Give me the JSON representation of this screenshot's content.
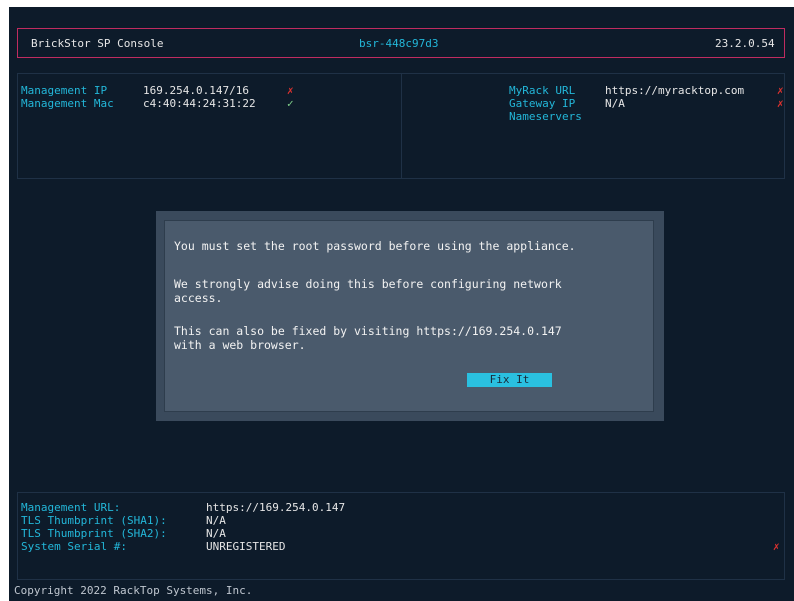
{
  "header": {
    "title": "BrickStor SP Console",
    "hostname": "bsr-448c97d3",
    "version": "23.2.0.54"
  },
  "network_left": {
    "mgmt_ip_label": "Management IP",
    "mgmt_ip_value": "169.254.0.147/16",
    "mgmt_ip_status": "✗",
    "mgmt_mac_label": "Management Mac",
    "mgmt_mac_value": "c4:40:44:24:31:22",
    "mgmt_mac_status": "✓"
  },
  "network_right": {
    "myrack_label": "MyRack URL",
    "myrack_value": "https://myracktop.com",
    "myrack_status": "✗",
    "gateway_label": "Gateway IP",
    "gateway_value": "N/A",
    "gateway_status": "✗",
    "nameservers_label": "Nameservers"
  },
  "dialog": {
    "line1": "You must set the root password before using the appliance.",
    "line2a": "We strongly advise doing this before configuring network",
    "line2b": "access.",
    "line3a": "This can also be fixed by visiting https://169.254.0.147",
    "line3b": "with a web browser.",
    "button_label": "Fix It"
  },
  "footer_info": {
    "url_label": "Management URL:",
    "url_value": "https://169.254.0.147",
    "sha1_label": "TLS Thumbprint (SHA1):",
    "sha1_value": "N/A",
    "sha2_label": "TLS Thumbprint (SHA2):",
    "sha2_value": "N/A",
    "serial_label": "System Serial #:",
    "serial_value": "UNREGISTERED",
    "serial_status": "✗"
  },
  "copyright": "Copyright 2022 RackTop Systems, Inc.",
  "colors": {
    "background": "#0d1b2a",
    "accent_cyan": "#23b7d9",
    "header_border": "#c02c60",
    "error_red": "#e0322f",
    "dialog_bg": "#4a5a6c"
  }
}
